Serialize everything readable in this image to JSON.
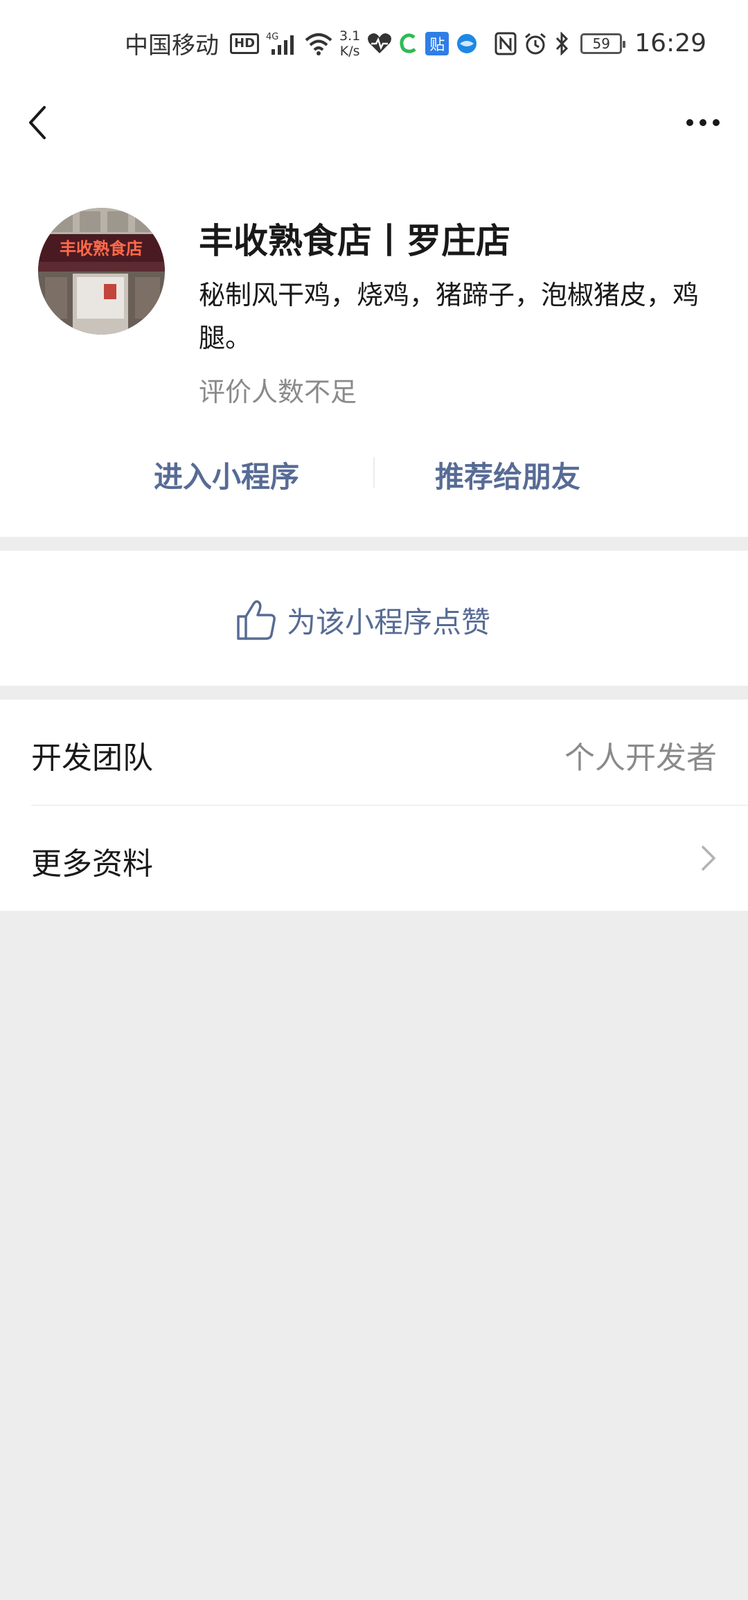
{
  "status_bar": {
    "carrier": "中国移动",
    "hd": "HD",
    "network": "4G",
    "speed_value": "3.1",
    "speed_unit": "K/s",
    "app_badge": "贴",
    "battery": "59",
    "time": "16:29"
  },
  "nav": {
    "back_icon": "chevron-left-icon",
    "more_icon": "more-dots-icon"
  },
  "profile": {
    "avatar_sign_text": "丰收熟食店",
    "name": "丰收熟食店丨罗庄店",
    "description": "秘制风干鸡，烧鸡，猪蹄子，泡椒猪皮，鸡腿。",
    "rating": "评价人数不足",
    "enter_label": "进入小程序",
    "recommend_label": "推荐给朋友"
  },
  "like": {
    "label": "为该小程序点赞",
    "icon": "thumbs-up-icon"
  },
  "info": {
    "dev_team_label": "开发团队",
    "dev_team_value": "个人开发者",
    "more_label": "更多资料"
  },
  "colors": {
    "accent": "#576b95",
    "background": "#ededed",
    "card": "#ffffff"
  }
}
